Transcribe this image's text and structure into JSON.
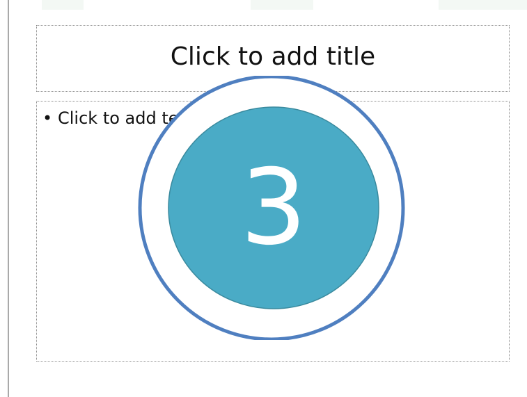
{
  "slide": {
    "title_placeholder": "Click to add title",
    "body_placeholder_bullet": "•",
    "body_placeholder_text": "Click to add text"
  },
  "countdown": {
    "number": "3",
    "ring_color": "#4f7fc0",
    "fill_color": "#4aabc6",
    "fill_stroke_color": "#3a8a9e",
    "number_color": "#ffffff"
  }
}
